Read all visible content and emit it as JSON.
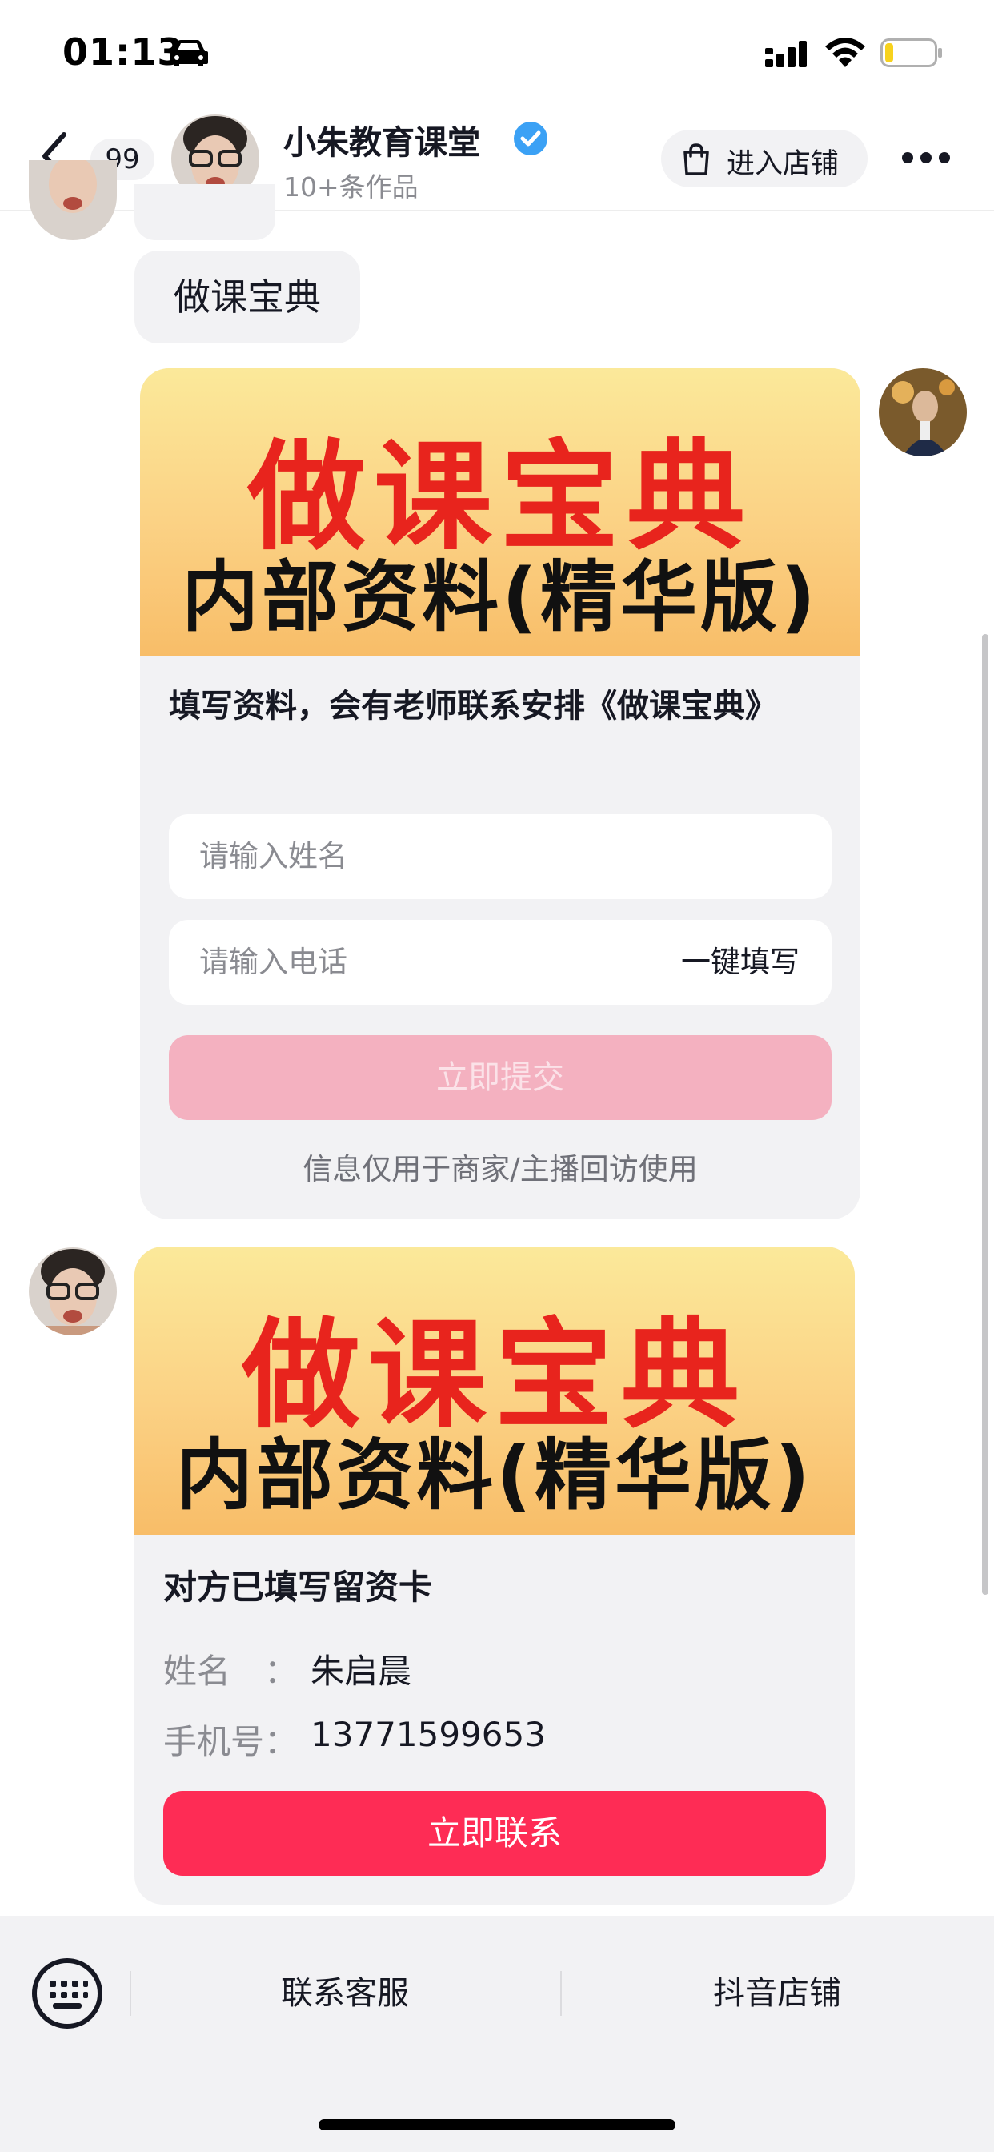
{
  "status_bar": {
    "time": "01:13"
  },
  "header": {
    "unread_count": "99",
    "shop_name": "小朱教育课堂",
    "works_count": "10+条作品",
    "enter_shop_label": "进入店铺"
  },
  "messages": {
    "bubble_text": "做课宝典",
    "form_card": {
      "banner_title": "做课宝典",
      "banner_subtitle": "内部资料(精华版)",
      "description": "填写资料，会有老师联系安排《做课宝典》",
      "name_placeholder": "请输入姓名",
      "phone_placeholder": "请输入电话",
      "one_key_fill": "一键填写",
      "submit_label": "立即提交",
      "privacy_note": "信息仅用于商家/主播回访使用"
    },
    "filled_card": {
      "banner_title": "做课宝典",
      "banner_subtitle": "内部资料(精华版)",
      "title": "对方已填写留资卡",
      "name_label": "姓名　：",
      "name_value": "朱启晨",
      "phone_label": "手机号：",
      "phone_value": "13771599653",
      "contact_label": "立即联系"
    }
  },
  "bottom_bar": {
    "link_service": "联系客服",
    "link_store": "抖音店铺"
  },
  "colors": {
    "accent": "#fe2c55",
    "submit_disabled": "#f4b1c0",
    "banner_red": "#e8241d",
    "bubble_bg": "#f2f2f4",
    "verified_blue": "#3ba1f5"
  },
  "icons": {
    "back": "back-arrow-icon",
    "verified": "verified-badge-icon",
    "shop": "shopping-bag-icon",
    "more": "more-dots-icon",
    "keyboard": "keyboard-icon"
  }
}
